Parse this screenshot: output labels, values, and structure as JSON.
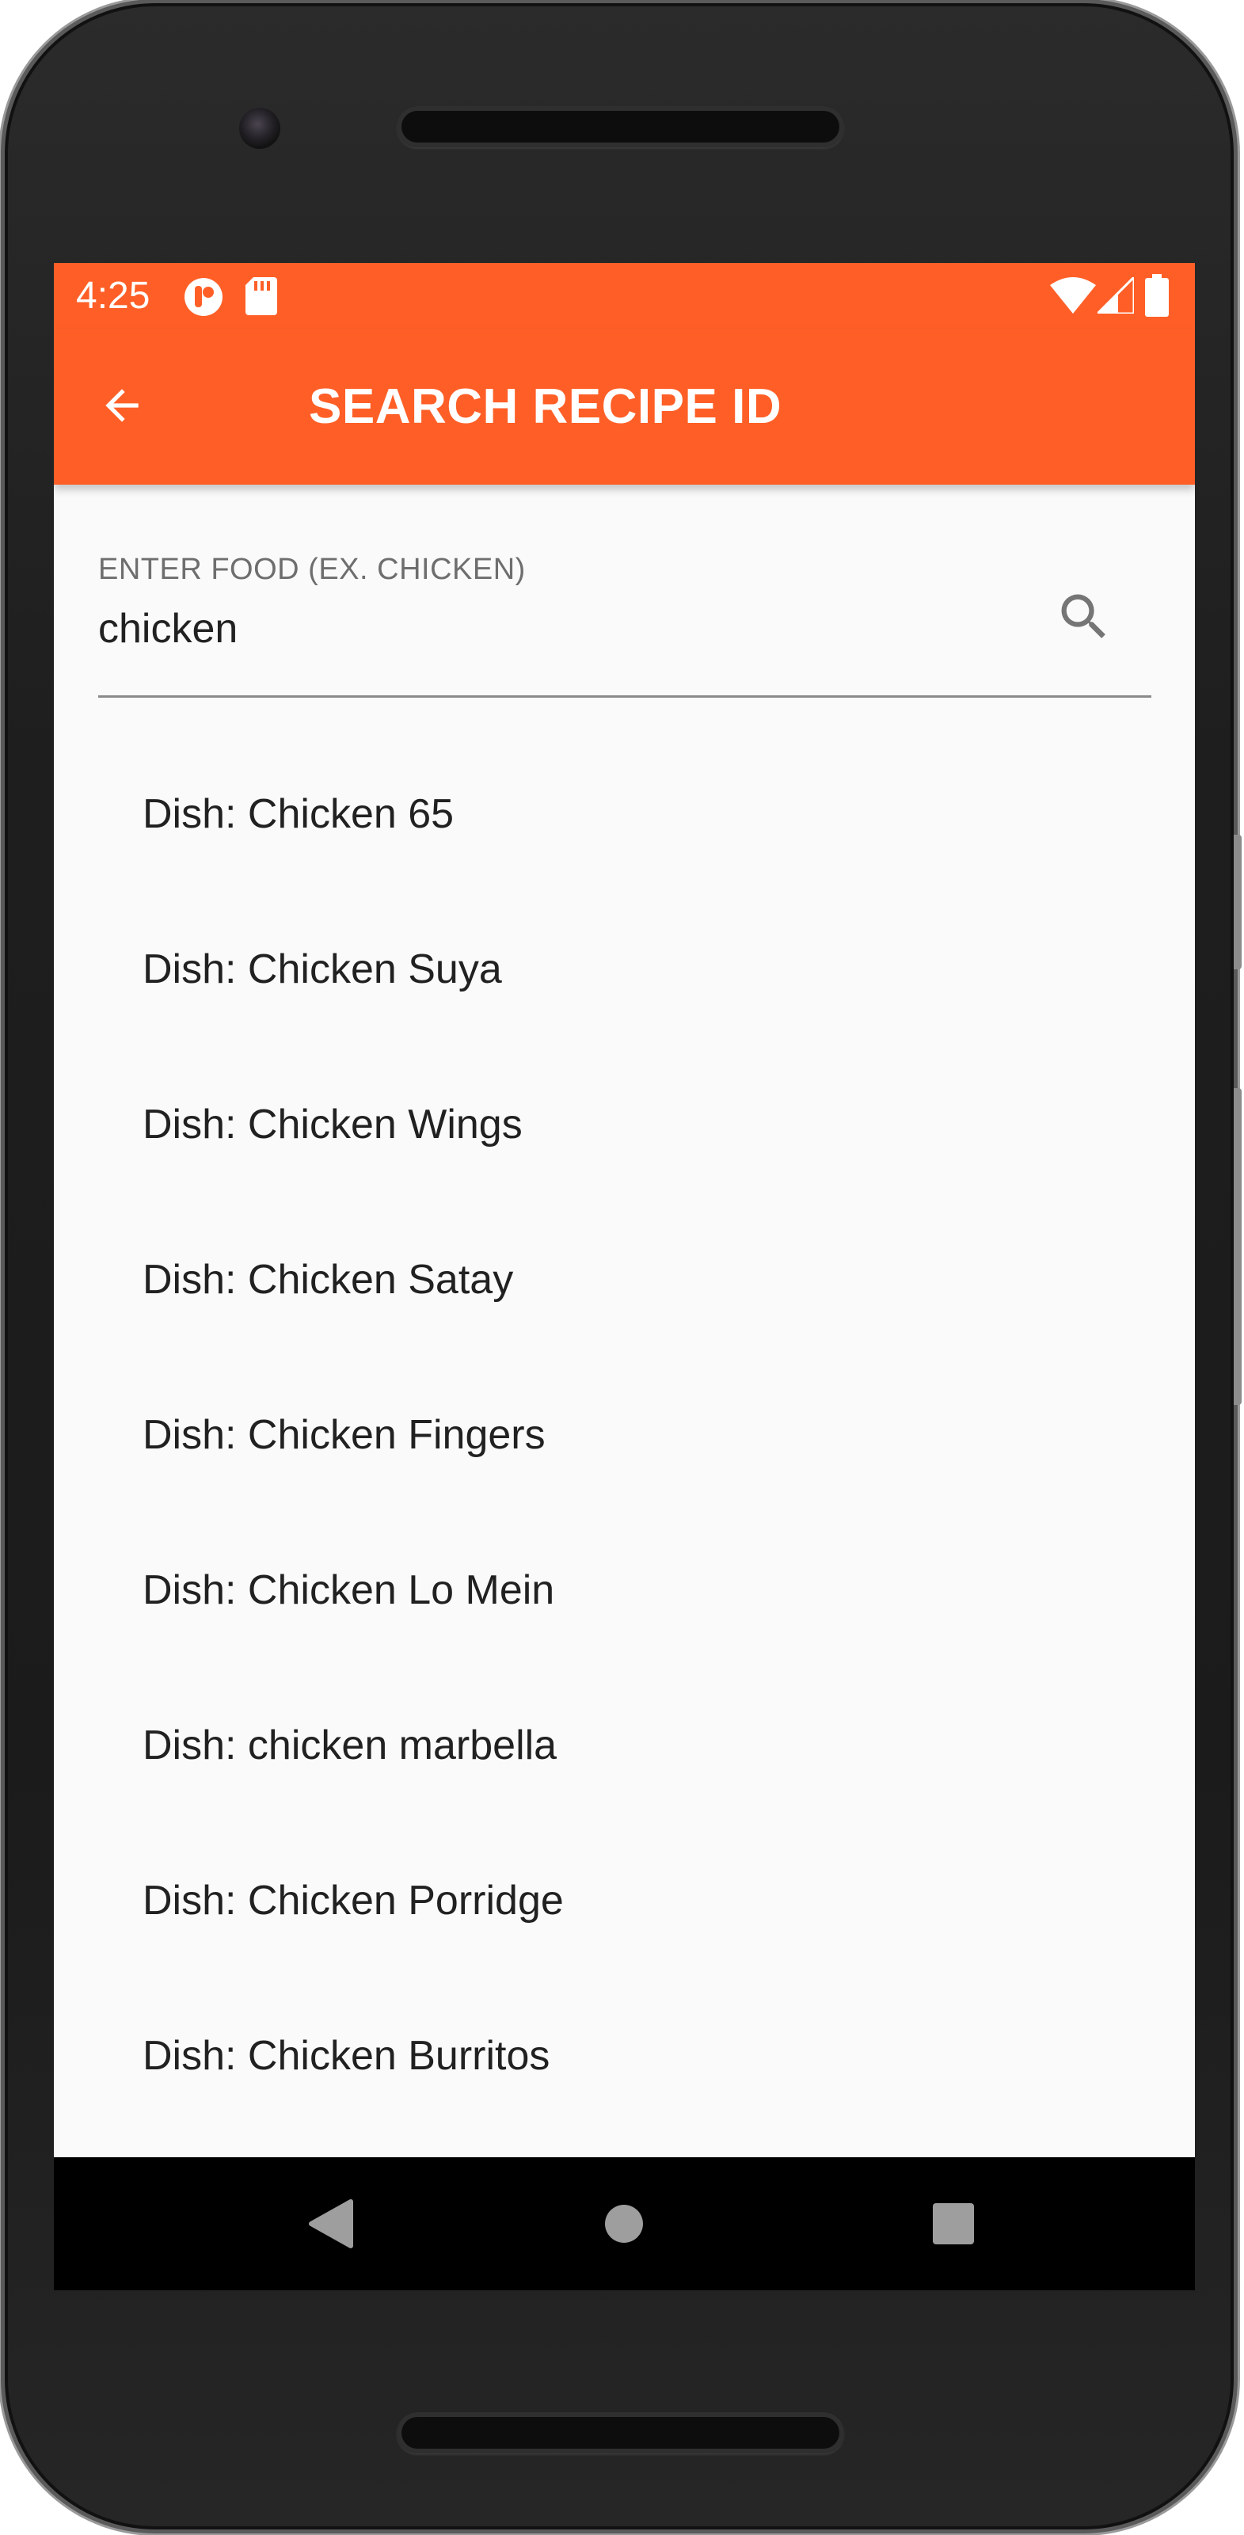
{
  "status_bar": {
    "time": "4:25",
    "left_icons": [
      "notification-app-icon",
      "sd-card-icon"
    ],
    "right_icons": [
      "wifi-icon",
      "cell-signal-icon",
      "battery-icon"
    ]
  },
  "app_bar": {
    "title": "SEARCH RECIPE ID",
    "back_icon": "arrow-left-icon",
    "background_color": "#ff5f27"
  },
  "search": {
    "label": "ENTER FOOD (EX. CHICKEN)",
    "value": "chicken",
    "icon": "search-icon"
  },
  "results": [
    "Dish: Chicken 65",
    "Dish: Chicken Suya",
    "Dish: Chicken Wings",
    "Dish: Chicken Satay",
    "Dish: Chicken Fingers",
    "Dish: Chicken Lo Mein",
    "Dish: chicken marbella",
    "Dish: Chicken Porridge",
    "Dish: Chicken Burritos"
  ],
  "nav_bar": {
    "buttons": [
      "back-triangle-icon",
      "home-circle-icon",
      "recents-square-icon"
    ]
  }
}
